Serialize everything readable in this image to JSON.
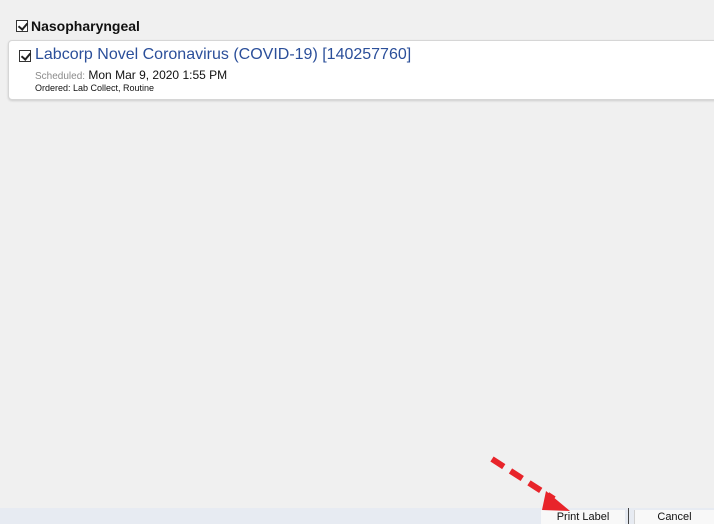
{
  "group": {
    "title": "Nasopharyngeal",
    "checked": true
  },
  "order": {
    "checked": true,
    "title": "Labcorp Novel Coronavirus (COVID-19) [140257760]",
    "scheduled_label": "Scheduled:",
    "scheduled_value": "Mon Mar 9, 2020 1:55 PM",
    "ordered_line": "Ordered: Lab Collect, Routine"
  },
  "footer": {
    "print_label": "Print Label",
    "cancel_label": "Cancel"
  },
  "colors": {
    "order_title": "#2b4f9a",
    "annotation_arrow": "#e8242a",
    "panel_bg": "#f0f0f0"
  }
}
